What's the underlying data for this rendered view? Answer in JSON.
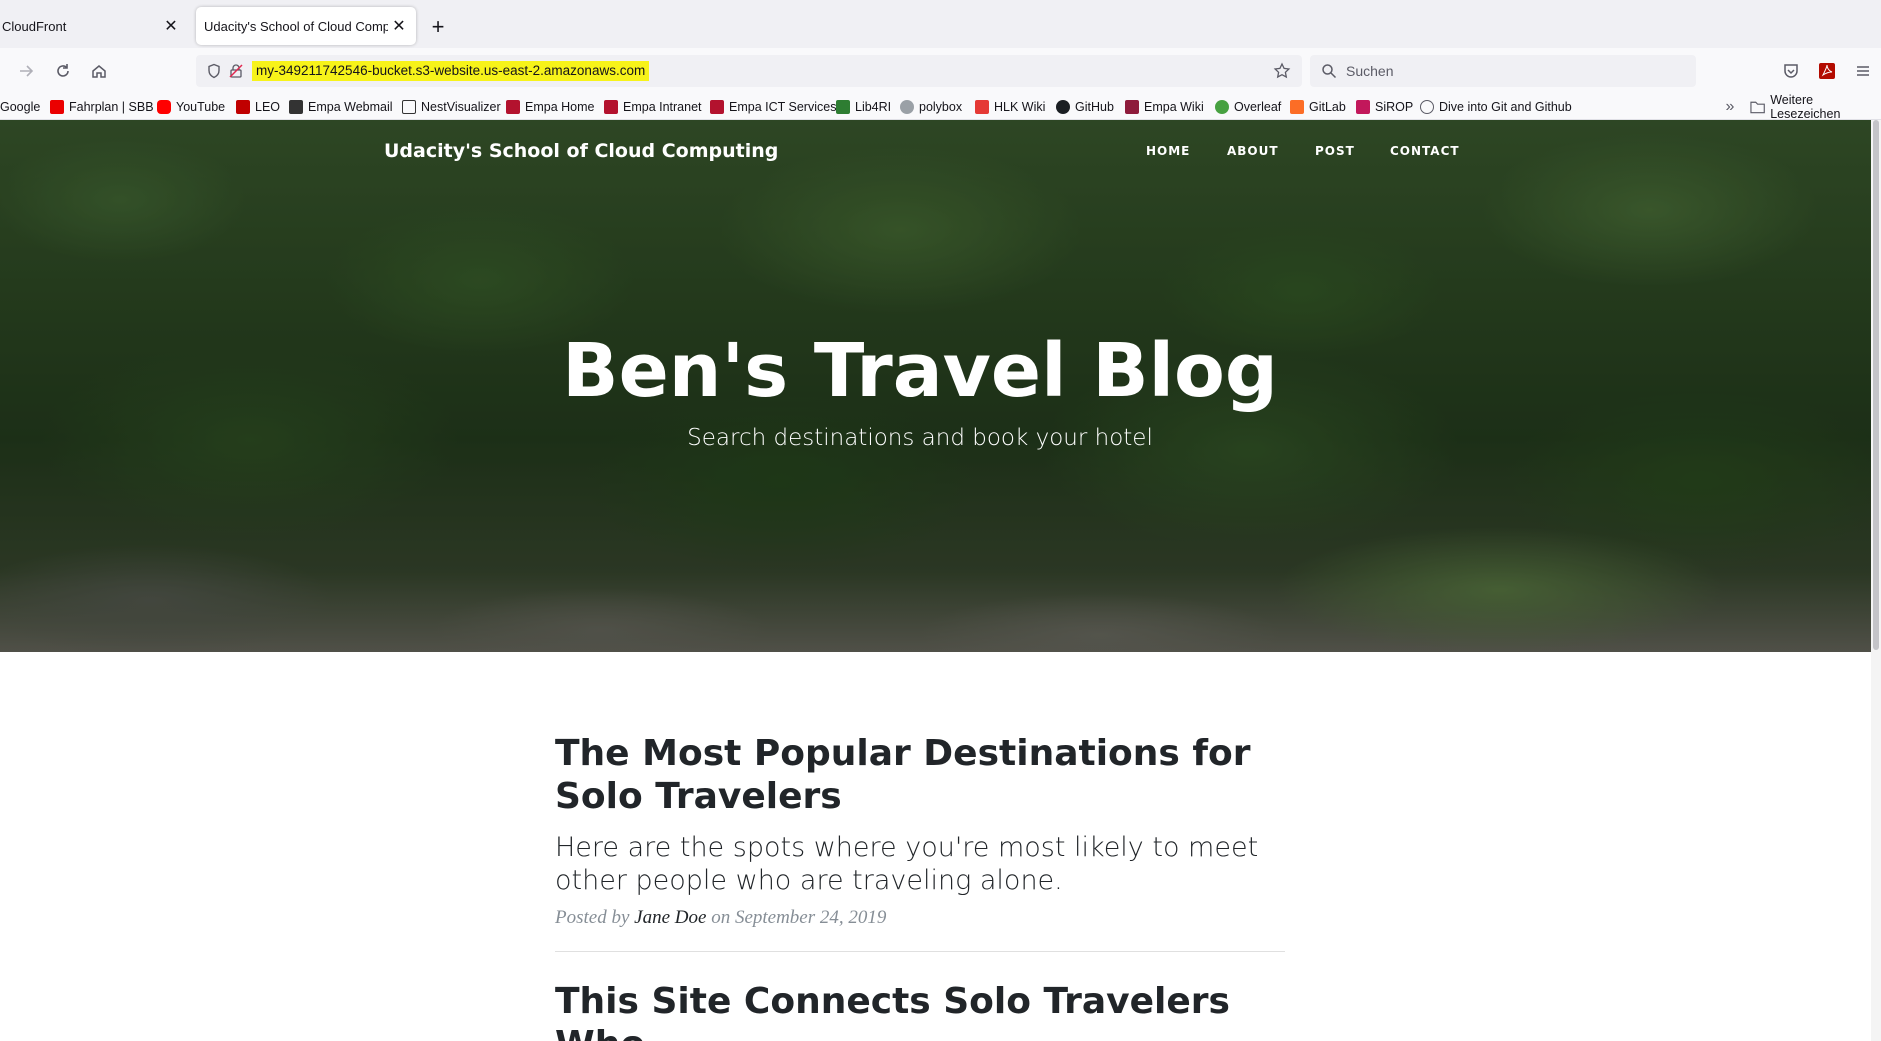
{
  "browser": {
    "tabs": [
      {
        "title": "CloudFront",
        "active": false
      },
      {
        "title": "Udacity's School of Cloud Computing",
        "active": true
      }
    ],
    "url": "my-349211742546-bucket.s3-website.us-east-2.amazonaws.com",
    "search_placeholder": "Suchen",
    "bookmarks": [
      {
        "label": "Google",
        "icon": "google-icon",
        "color": "#4285f4"
      },
      {
        "label": "Fahrplan | SBB",
        "icon": "sbb-icon",
        "color": "#eb0000"
      },
      {
        "label": "YouTube",
        "icon": "youtube-icon",
        "color": "#ff0000"
      },
      {
        "label": "LEO",
        "icon": "leo-icon",
        "color": "#c00000"
      },
      {
        "label": "Empa Webmail",
        "icon": "webmail-icon",
        "color": "#333333"
      },
      {
        "label": "NestVisualizer",
        "icon": "nest-icon",
        "color": "#333333"
      },
      {
        "label": "Empa Home",
        "icon": "empa-icon",
        "color": "#b3122e"
      },
      {
        "label": "Empa Intranet",
        "icon": "empa-icon",
        "color": "#b3122e"
      },
      {
        "label": "Empa ICT Services",
        "icon": "empa-icon",
        "color": "#b3122e"
      },
      {
        "label": "Lib4RI",
        "icon": "lib4ri-icon",
        "color": "#2e7d32"
      },
      {
        "label": "polybox",
        "icon": "cloud-icon",
        "color": "#9aa0a6"
      },
      {
        "label": "HLK Wiki",
        "icon": "hlk-icon",
        "color": "#e53935"
      },
      {
        "label": "GitHub",
        "icon": "github-icon",
        "color": "#1b1f23"
      },
      {
        "label": "Empa Wiki",
        "icon": "wiki-icon",
        "color": "#8e1b3b"
      },
      {
        "label": "Overleaf",
        "icon": "overleaf-icon",
        "color": "#47a141"
      },
      {
        "label": "GitLab",
        "icon": "gitlab-icon",
        "color": "#fc6d26"
      },
      {
        "label": "SiROP",
        "icon": "sirop-icon",
        "color": "#c2185b"
      },
      {
        "label": "Dive into Git and Github",
        "icon": "globe-icon",
        "color": "#5b5b66"
      }
    ],
    "other_bookmarks": "Weitere Lesezeichen"
  },
  "site": {
    "brand": "Udacity's School of Cloud Computing",
    "nav": [
      "HOME",
      "ABOUT",
      "POST",
      "CONTACT"
    ],
    "hero_title": "Ben's Travel Blog",
    "hero_subtitle": "Search destinations and book your hotel"
  },
  "posts": [
    {
      "title": "The Most Popular Destinations for Solo Travelers",
      "subtitle": "Here are the spots where you're most likely to meet other people who are traveling alone.",
      "posted_by": "Posted by",
      "author": "Jane Doe",
      "date_prefix": "on",
      "date": "September 24, 2019"
    },
    {
      "title": "This Site Connects Solo Travelers Who"
    }
  ]
}
